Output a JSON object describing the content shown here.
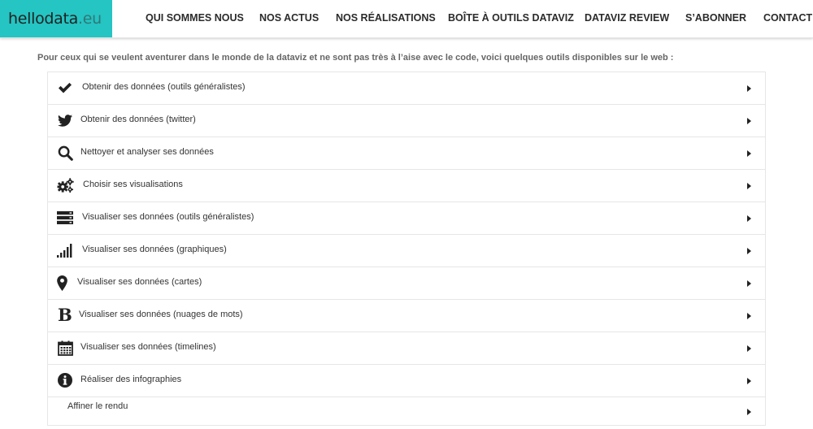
{
  "brand": {
    "name": "hellodata",
    "tld": ".eu",
    "background": "#24c5c3"
  },
  "nav": [
    {
      "label": "QUI SOMMES NOUS"
    },
    {
      "label": "NOS ACTUS"
    },
    {
      "label": "NOS RÉALISATIONS"
    },
    {
      "label": "BOÎTE À OUTILS DATAVIZ"
    },
    {
      "label": "DATAVIZ REVIEW"
    },
    {
      "label": "S’ABONNER"
    },
    {
      "label": "CONTACT"
    }
  ],
  "intro": "Pour ceux qui se veulent aventurer dans le monde de la dataviz et ne sont pas très à l’aise avec le code, voici quelques outils disponibles sur le web :",
  "accordion": [
    {
      "label": "Obtenir des données (outils généralistes)",
      "icon": "check-icon"
    },
    {
      "label": "Obtenir des données (twitter)",
      "icon": "twitter-icon"
    },
    {
      "label": "Nettoyer et analyser ses données",
      "icon": "search-icon"
    },
    {
      "label": "Choisir ses visualisations",
      "icon": "gears-icon"
    },
    {
      "label": "Visualiser ses données (outils généralistes)",
      "icon": "server-icon"
    },
    {
      "label": "Visualiser ses données (graphiques)",
      "icon": "signal-icon"
    },
    {
      "label": "Visualiser ses données (cartes)",
      "icon": "map-marker-icon"
    },
    {
      "label": "Visualiser ses données (nuages de mots)",
      "icon": "bold-icon"
    },
    {
      "label": "Visualiser ses données (timelines)",
      "icon": "calendar-icon"
    },
    {
      "label": "Réaliser des infographies",
      "icon": "info-circle-icon"
    },
    {
      "label": "Affiner le rendu",
      "icon": ""
    }
  ]
}
